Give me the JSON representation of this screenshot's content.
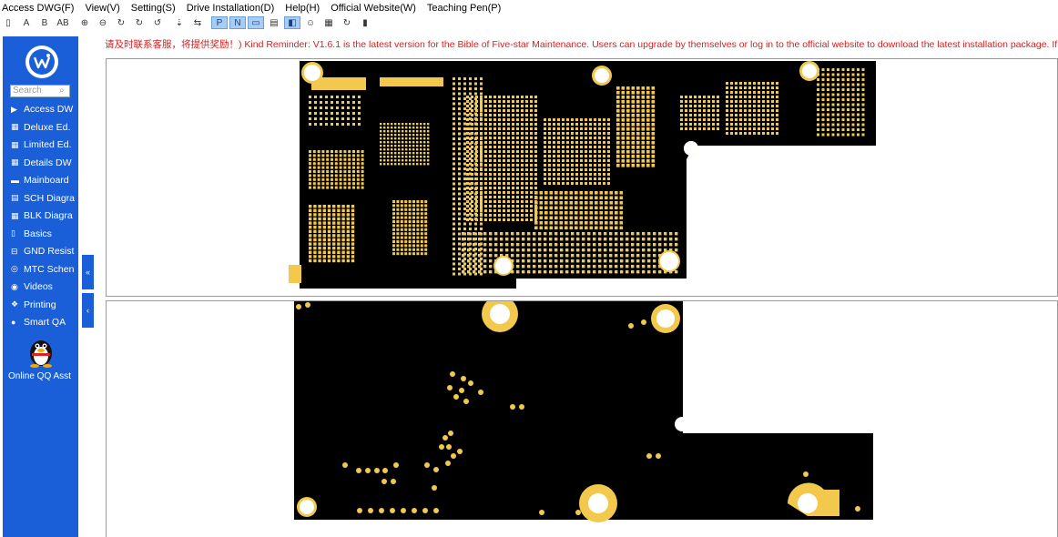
{
  "menu": [
    {
      "label": "Access DWG(F)"
    },
    {
      "label": "View(V)"
    },
    {
      "label": "Setting(S)"
    },
    {
      "label": "Drive Installation(D)"
    },
    {
      "label": "Help(H)"
    },
    {
      "label": "Official Website(W)"
    },
    {
      "label": "Teaching Pen(P)"
    }
  ],
  "toolbar": {
    "items": [
      {
        "icon": "cursor-icon",
        "glyph": "▯"
      },
      {
        "icon": "text-a-icon",
        "glyph": "A"
      },
      {
        "icon": "text-b-icon",
        "glyph": "B"
      },
      {
        "icon": "ab-icon",
        "glyph": "AB"
      },
      {
        "icon": "zoom-in-icon",
        "glyph": "⊕"
      },
      {
        "icon": "zoom-out-icon",
        "glyph": "⊖"
      },
      {
        "icon": "rotate-icon",
        "glyph": "↻"
      },
      {
        "icon": "rotate-cw-icon",
        "glyph": "↻"
      },
      {
        "icon": "rotate-ccw-icon",
        "glyph": "↺"
      },
      {
        "icon": "mirror-icon",
        "glyph": "⇣"
      },
      {
        "icon": "flip-icon",
        "glyph": "⇆"
      },
      {
        "icon": "p-view-icon",
        "glyph": "P",
        "active": true
      },
      {
        "icon": "n-view-icon",
        "glyph": "N",
        "active": true
      },
      {
        "icon": "screen-icon",
        "glyph": "▭",
        "active": true
      },
      {
        "icon": "list-icon",
        "glyph": "▤"
      },
      {
        "icon": "speaker-icon",
        "glyph": "◧",
        "active": true
      },
      {
        "icon": "user-icon",
        "glyph": "☺"
      },
      {
        "icon": "palette-icon",
        "glyph": "▦"
      },
      {
        "icon": "refresh-icon",
        "glyph": "↻"
      },
      {
        "icon": "clear-icon",
        "glyph": "▮"
      }
    ]
  },
  "sidebar": {
    "search_placeholder": "Search",
    "items": [
      {
        "label": "Access DW",
        "icon": "triangle-right-icon"
      },
      {
        "label": "Deluxe Ed.",
        "icon": "grid-icon"
      },
      {
        "label": "Limited Ed.",
        "icon": "grid-icon"
      },
      {
        "label": "Details DW",
        "icon": "grid-icon"
      },
      {
        "label": "Mainboard",
        "icon": "board-icon"
      },
      {
        "label": "SCH Diagra",
        "icon": "schematic-icon"
      },
      {
        "label": "BLK Diagra",
        "icon": "block-icon"
      },
      {
        "label": "Basics",
        "icon": "phone-icon"
      },
      {
        "label": "GND Resist",
        "icon": "gnd-icon"
      },
      {
        "label": "MTC Schen",
        "icon": "mtc-icon"
      },
      {
        "label": "Videos",
        "icon": "video-icon"
      },
      {
        "label": "Printing",
        "icon": "print-icon"
      },
      {
        "label": "Smart QA",
        "icon": "chat-icon"
      }
    ],
    "qq_label": "Online QQ Asst"
  },
  "reminder": "请及时联系客服，将提供奖励！) Kind Reminder: V1.6.1 is the latest version for the Bible of Five-star Maintenance. Users can upgrade by themselves or log in to the official website to download the latest installation package. If you",
  "colors": {
    "sidebar": "#1a5fd8",
    "pcb_black": "#000000",
    "pad_gold": "#f2c94c",
    "reminder": "#d81e1e"
  }
}
